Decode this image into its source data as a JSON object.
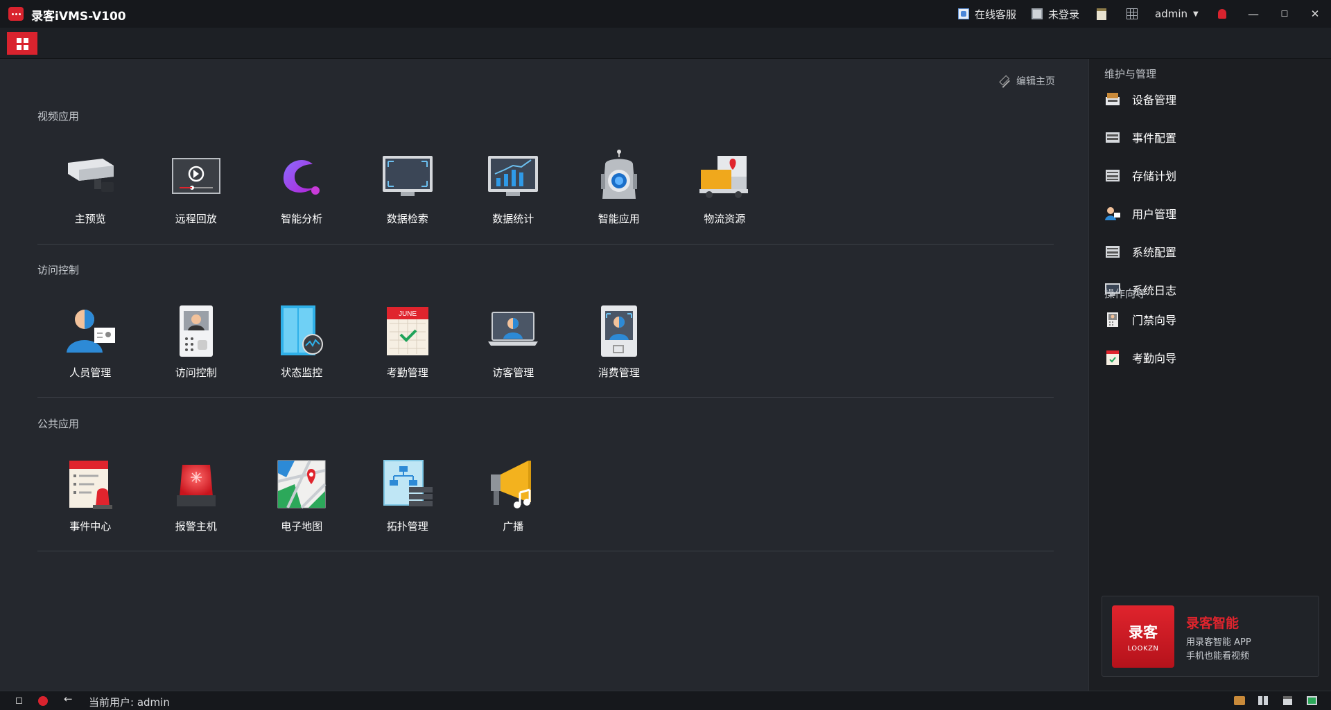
{
  "app": {
    "title": "录客iVMS-V100"
  },
  "titlebar": {
    "online_service": "在线客服",
    "login_status": "未登录",
    "user": "admin"
  },
  "main": {
    "edit_home": "编辑主页",
    "sections": [
      {
        "title": "视频应用",
        "apps": [
          {
            "label": "主预览",
            "icon": "camera-icon"
          },
          {
            "label": "远程回放",
            "icon": "playback-icon"
          },
          {
            "label": "智能分析",
            "icon": "analysis-icon"
          },
          {
            "label": "数据检索",
            "icon": "search-monitor-icon"
          },
          {
            "label": "数据统计",
            "icon": "stats-monitor-icon"
          },
          {
            "label": "智能应用",
            "icon": "robot-camera-icon"
          },
          {
            "label": "物流资源",
            "icon": "logistics-truck-icon"
          }
        ]
      },
      {
        "title": "访问控制",
        "apps": [
          {
            "label": "人员管理",
            "icon": "person-card-icon"
          },
          {
            "label": "访问控制",
            "icon": "intercom-icon"
          },
          {
            "label": "状态监控",
            "icon": "door-monitor-icon"
          },
          {
            "label": "考勤管理",
            "icon": "calendar-june-icon"
          },
          {
            "label": "访客管理",
            "icon": "visitor-laptop-icon"
          },
          {
            "label": "消费管理",
            "icon": "face-terminal-icon"
          }
        ]
      },
      {
        "title": "公共应用",
        "apps": [
          {
            "label": "事件中心",
            "icon": "event-center-icon"
          },
          {
            "label": "报警主机",
            "icon": "alarm-host-icon"
          },
          {
            "label": "电子地图",
            "icon": "map-icon"
          },
          {
            "label": "拓扑管理",
            "icon": "topology-icon"
          },
          {
            "label": "广播",
            "icon": "broadcast-icon"
          }
        ]
      }
    ]
  },
  "right_panel": {
    "maintenance_title": "维护与管理",
    "maintenance_items": [
      {
        "label": "设备管理",
        "icon": "device-icon"
      },
      {
        "label": "事件配置",
        "icon": "event-config-icon"
      },
      {
        "label": "存储计划",
        "icon": "storage-icon"
      },
      {
        "label": "用户管理",
        "icon": "user-icon"
      },
      {
        "label": "系统配置",
        "icon": "system-config-icon"
      },
      {
        "label": "系统日志",
        "icon": "log-monitor-icon"
      }
    ],
    "guide_title": "操作向导",
    "guide_items": [
      {
        "label": "门禁向导",
        "icon": "door-guide-icon"
      },
      {
        "label": "考勤向导",
        "icon": "attendance-guide-icon"
      }
    ],
    "promo": {
      "logo_main": "录客",
      "logo_sub": "LOOKZN",
      "title": "录客智能",
      "line1": "用录客智能 APP",
      "line2": "手机也能看视频"
    }
  },
  "statusbar": {
    "current_user": "当前用户: admin"
  },
  "colors": {
    "accent": "#d9232e",
    "background": "#25282e",
    "panel": "#1c1e22"
  }
}
